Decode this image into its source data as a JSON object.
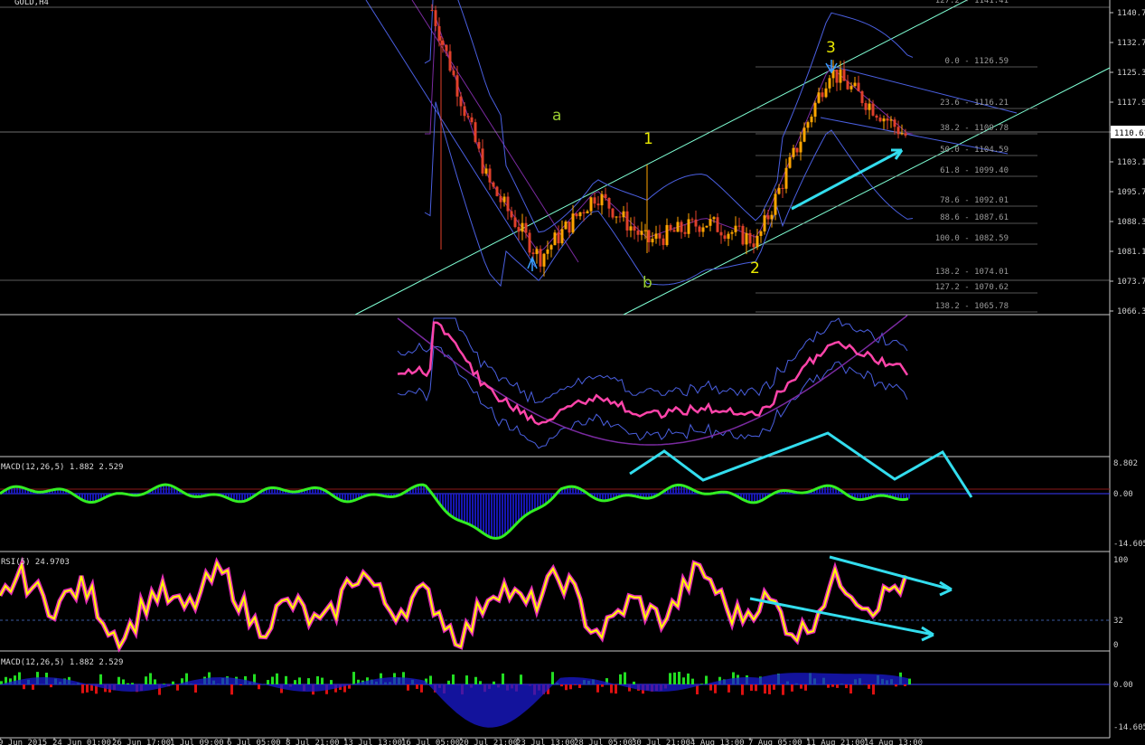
{
  "colors": {
    "background": "#000000",
    "bull_candle": "#ffa500",
    "bear_candle": "#e0402a",
    "channel": "#7fffd4",
    "bollinger": "#4a5fe0",
    "fib": "#7a7a7a",
    "annotation_arrow": "#33ddee",
    "macd_line": "#33ee22",
    "macd_hist": "#1a1ad0",
    "rsi_line": "#ffff00",
    "rsi_glow": "#ff33cc",
    "hist_up": "#22dd22",
    "hist_down": "#dd1111"
  },
  "symbol_title": "GOLD,H4",
  "price_label": "1110.61",
  "panels": {
    "macd1_title": "MACD(12,26,5) 1.882 2.529",
    "rsi_title": "RSI(5) 24.9703",
    "macd2_title": "MACD(12,26,5) 1.882 2.529"
  },
  "waves": {
    "a": "a",
    "b": "b",
    "w1": "1",
    "w2": "2",
    "w3": "3"
  },
  "fib_levels": [
    "127.2 - 1141.41",
    "0.0 - 1126.59",
    "23.6 - 1116.21",
    "38.2 - 1109.78",
    "50.0 - 1104.59",
    "61.8 - 1099.40",
    "78.6 - 1092.01",
    "88.6 - 1087.61",
    "100.0 - 1082.59",
    "138.2 - 1074.01",
    "127.2 - 1070.62",
    "138.2 - 1065.78"
  ],
  "chart_data": [
    {
      "type": "line",
      "title": "GOLD,H4",
      "price_axis_ticks": [
        "1140.71",
        "1132.77",
        "1125.37",
        "1117.97",
        "1110.61",
        "1103.17",
        "1095.77",
        "1088.37",
        "1081.17",
        "1073.77",
        "1066.37"
      ],
      "x_ticks": [
        "9 Jun 2015",
        "24 Jun 01:00",
        "26 Jun 17:00",
        "1 Jul 09:00",
        "6 Jul 05:00",
        "8 Jul 21:00",
        "13 Jul 13:00",
        "16 Jul 05:00",
        "20 Jul 21:00",
        "23 Jul 13:00",
        "28 Jul 05:00",
        "30 Jul 21:00",
        "4 Aug 13:00",
        "7 Aug 05:00",
        "11 Aug 21:00",
        "14 Aug 13:00"
      ],
      "current_price": 1110.61,
      "ylim": [
        1066.37,
        1140.71
      ],
      "series": [
        {
          "x": [
            "16 Jul 05:00",
            "20 Jul 21:00",
            "23 Jul 13:00",
            "28 Jul 05:00",
            "30 Jul 21:00",
            "4 Aug 13:00",
            "7 Aug 05:00",
            "11 Aug 21:00",
            "14 Aug 13:00"
          ],
          "values": [
            1141,
            1098,
            1079,
            1095,
            1083,
            1088,
            1083,
            1126,
            1109
          ]
        }
      ]
    },
    {
      "type": "line",
      "title": "MACD(12,26,5) 1.882 2.529",
      "axis_ticks": [
        "8.802",
        "0.00",
        "-14.605"
      ],
      "ylim": [
        -14.605,
        8.802
      ]
    },
    {
      "type": "line",
      "title": "RSI(5) 24.9703",
      "axis_ticks": [
        "100",
        "32",
        "0"
      ],
      "ylim": [
        0,
        100
      ],
      "last_value": 24.9703
    },
    {
      "type": "bar",
      "title": "MACD(12,26,5) 1.882 2.529",
      "axis_ticks": [
        "0.00",
        "-14.605"
      ]
    }
  ]
}
